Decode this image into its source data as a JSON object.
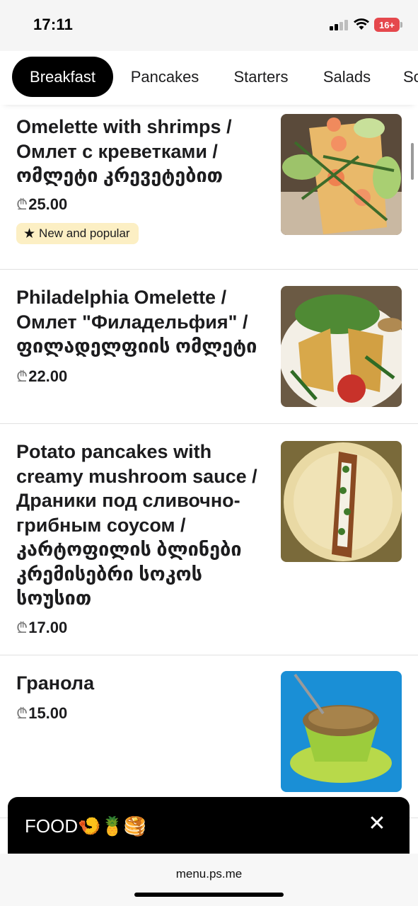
{
  "status": {
    "time": "17:11",
    "battery": "16+"
  },
  "tabs": [
    {
      "label": "Breakfast",
      "active": true
    },
    {
      "label": "Pancakes",
      "active": false
    },
    {
      "label": "Starters",
      "active": false
    },
    {
      "label": "Salads",
      "active": false
    },
    {
      "label": "So",
      "active": false
    }
  ],
  "menu": {
    "currency_symbol": "₾",
    "items": [
      {
        "title": "Omelette with shrimps / Омлет с креветками / ომლეტი კრევეტებით",
        "price": "25.00",
        "badge": "New and popular"
      },
      {
        "title": "Philadelphia Omelette / Омлет \"Филадельфия\" / ფილადელფიის ომლეტი",
        "price": "22.00"
      },
      {
        "title": "Potato pancakes with creamy mushroom sauce / Драники под сливочно-грибным соусом / კარტოფილის ბლინები კრემისებრი სოკოს სოუსით",
        "price": "17.00"
      },
      {
        "title": "Гранола",
        "price": "15.00"
      }
    ]
  },
  "footer_bar": {
    "label": "FOOD🍤🍍🥞",
    "close_icon": "close-icon"
  },
  "browser": {
    "url": "menu.ps.me"
  },
  "colors": {
    "accent": "#000000",
    "badge_bg": "#fcefc4",
    "background": "#ffffff"
  }
}
